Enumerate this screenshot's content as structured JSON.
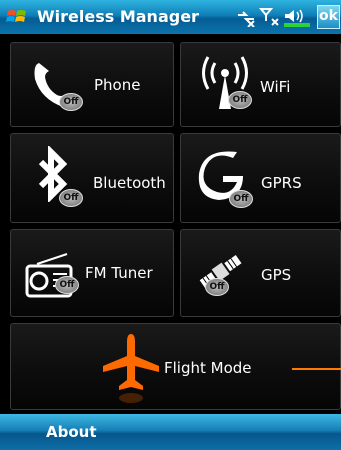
{
  "titlebar": {
    "title": "Wireless Manager",
    "ok_label": "ok"
  },
  "tiles": {
    "phone": {
      "label": "Phone",
      "badge": "Off"
    },
    "wifi": {
      "label": "WiFi",
      "badge": "Off"
    },
    "bluetooth": {
      "label": "Bluetooth",
      "badge": "Off"
    },
    "gprs": {
      "label": "GPRS",
      "badge": "Off"
    },
    "fm": {
      "label": "FM Tuner",
      "badge": "Off"
    },
    "gps": {
      "label": "GPS",
      "badge": "Off"
    },
    "flight": {
      "label": "Flight Mode"
    }
  },
  "bottombar": {
    "about_label": "About"
  },
  "colors": {
    "accent_blue": "#0f7fb8",
    "flight_orange": "#ff6a00"
  }
}
